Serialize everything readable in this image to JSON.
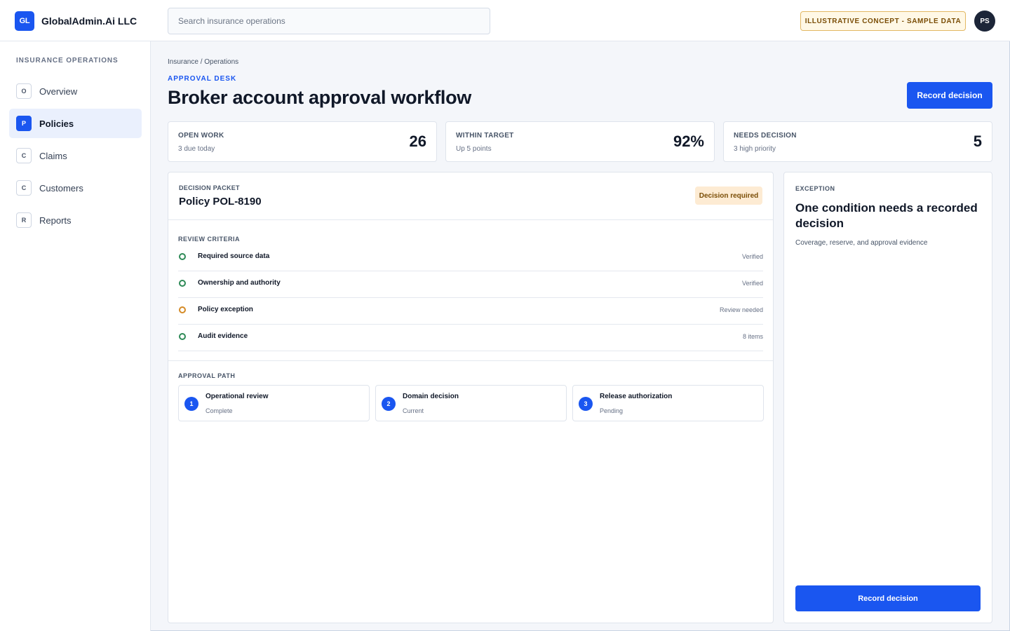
{
  "app": {
    "brand_initials": "GL",
    "brand_name": "GlobalAdmin.Ai LLC",
    "search_placeholder": "Search insurance operations",
    "concept_badge": "ILLUSTRATIVE CONCEPT - SAMPLE DATA",
    "avatar_initials": "PS"
  },
  "sidebar": {
    "heading": "INSURANCE OPERATIONS",
    "items": [
      {
        "icon_letter": "O",
        "label": "Overview",
        "active": false
      },
      {
        "icon_letter": "P",
        "label": "Policies",
        "active": true
      },
      {
        "icon_letter": "C",
        "label": "Claims",
        "active": false
      },
      {
        "icon_letter": "C",
        "label": "Customers",
        "active": false
      },
      {
        "icon_letter": "R",
        "label": "Reports",
        "active": false
      }
    ]
  },
  "header": {
    "breadcrumb": "Insurance / Operations",
    "eyebrow": "APPROVAL DESK",
    "title": "Broker account approval workflow",
    "primary_button": "Record decision"
  },
  "stats": [
    {
      "label": "OPEN WORK",
      "sub": "3 due today",
      "value": "26"
    },
    {
      "label": "WITHIN TARGET",
      "sub": "Up 5 points",
      "value": "92%"
    },
    {
      "label": "NEEDS DECISION",
      "sub": "3 high priority",
      "value": "5"
    }
  ],
  "packet": {
    "eyebrow": "DECISION PACKET",
    "title": "Policy POL-8190",
    "badge": "Decision required",
    "criteria_heading": "REVIEW CRITERIA",
    "criteria": [
      {
        "name": "Required source data",
        "status": "Verified",
        "state": "ok"
      },
      {
        "name": "Ownership and authority",
        "status": "Verified",
        "state": "ok"
      },
      {
        "name": "Policy exception",
        "status": "Review needed",
        "state": "warn"
      },
      {
        "name": "Audit evidence",
        "status": "8 items",
        "state": "ok"
      }
    ],
    "path_heading": "APPROVAL PATH",
    "steps": [
      {
        "num": "1",
        "title": "Operational review",
        "status": "Complete"
      },
      {
        "num": "2",
        "title": "Domain decision",
        "status": "Current"
      },
      {
        "num": "3",
        "title": "Release authorization",
        "status": "Pending"
      }
    ]
  },
  "exception": {
    "eyebrow": "EXCEPTION",
    "title": "One condition needs a recorded decision",
    "description": "Coverage, reserve, and approval evidence",
    "button": "Record decision"
  },
  "colors": {
    "accent": "#1a56f0",
    "ok": "#2e8a57",
    "warn": "#d48a26",
    "badge_bg": "#fdebd3"
  }
}
